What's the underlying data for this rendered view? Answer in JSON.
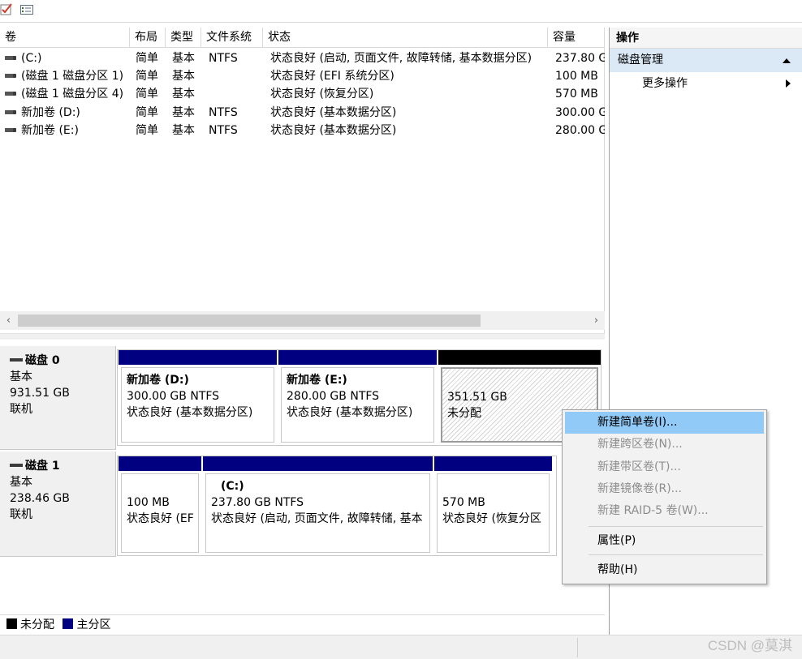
{
  "toolbar": {
    "buttons": [
      {
        "icon": "checklist-icon"
      },
      {
        "icon": "properties-list-icon"
      }
    ]
  },
  "volume_list": {
    "columns": [
      "卷",
      "布局",
      "类型",
      "文件系统",
      "状态",
      "容量"
    ],
    "rows": [
      {
        "volume": "(C:)",
        "layout": "简单",
        "type": "基本",
        "fs": "NTFS",
        "status": "状态良好 (启动, 页面文件, 故障转储, 基本数据分区)",
        "capacity": "237.80 G"
      },
      {
        "volume": "(磁盘 1 磁盘分区 1)",
        "layout": "简单",
        "type": "基本",
        "fs": "",
        "status": "状态良好 (EFI 系统分区)",
        "capacity": "100 MB"
      },
      {
        "volume": "(磁盘 1 磁盘分区 4)",
        "layout": "简单",
        "type": "基本",
        "fs": "",
        "status": "状态良好 (恢复分区)",
        "capacity": "570 MB"
      },
      {
        "volume": "新加卷 (D:)",
        "layout": "简单",
        "type": "基本",
        "fs": "NTFS",
        "status": "状态良好 (基本数据分区)",
        "capacity": "300.00 G"
      },
      {
        "volume": "新加卷 (E:)",
        "layout": "简单",
        "type": "基本",
        "fs": "NTFS",
        "status": "状态良好 (基本数据分区)",
        "capacity": "280.00 G"
      }
    ],
    "scroll_left": "‹",
    "scroll_right": "›"
  },
  "disks": [
    {
      "name": "磁盘 0",
      "type": "基本",
      "size": "931.51 GB",
      "state": "联机",
      "partitions": [
        {
          "title": "新加卷 (D:)",
          "line1": "300.00 GB NTFS",
          "line2": "状态良好 (基本数据分区)"
        },
        {
          "title": "新加卷 (E:)",
          "line1": "280.00 GB NTFS",
          "line2": "状态良好 (基本数据分区)"
        },
        {
          "title": "",
          "line1": "351.51 GB",
          "line2": "未分配"
        }
      ]
    },
    {
      "name": "磁盘 1",
      "type": "基本",
      "size": "238.46 GB",
      "state": "联机",
      "partitions": [
        {
          "title": "",
          "line1": "100 MB",
          "line2": "状态良好 (EF"
        },
        {
          "title": "(C:)",
          "line1": "237.80 GB NTFS",
          "line2": "状态良好 (启动, 页面文件, 故障转储, 基本"
        },
        {
          "title": "",
          "line1": "570 MB",
          "line2": "状态良好 (恢复分区"
        }
      ]
    }
  ],
  "legend": {
    "unallocated": {
      "label": "未分配",
      "color": "#000000"
    },
    "primary": {
      "label": "主分区",
      "color": "#000080"
    }
  },
  "actions": {
    "title": "操作",
    "section": "磁盘管理",
    "more": "更多操作"
  },
  "context_menu": {
    "items": [
      {
        "label": "新建简单卷(I)...",
        "enabled": true
      },
      {
        "label": "新建跨区卷(N)...",
        "enabled": false
      },
      {
        "label": "新建带区卷(T)...",
        "enabled": false
      },
      {
        "label": "新建镜像卷(R)...",
        "enabled": false
      },
      {
        "label": "新建 RAID-5 卷(W)...",
        "enabled": false
      },
      {
        "label": "属性(P)",
        "enabled": true
      },
      {
        "label": "帮助(H)",
        "enabled": true
      }
    ]
  },
  "watermark": "CSDN @莫淇",
  "colors": {
    "highlight": "#91c9f7",
    "section_bg": "#dbe9f7",
    "primary_partition": "#000080"
  }
}
